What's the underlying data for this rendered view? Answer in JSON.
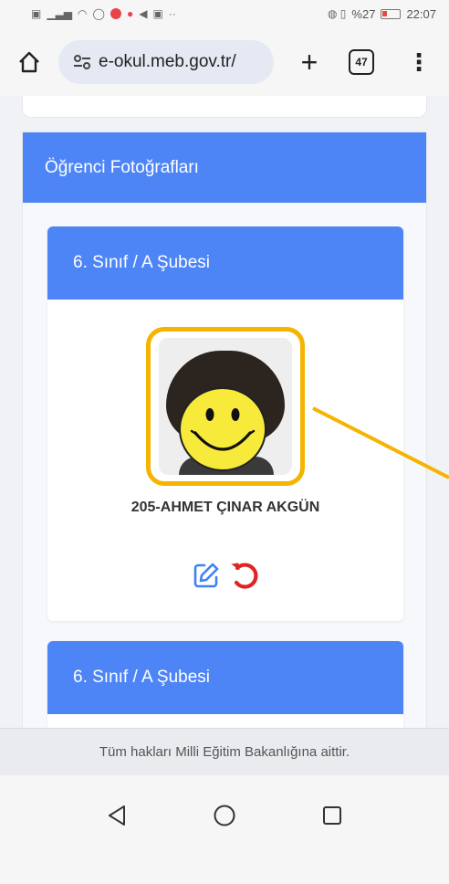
{
  "status": {
    "left_icons": [
      "sim-icon",
      "signal-icon",
      "wifi-icon",
      "whatsapp-icon",
      "app-icon",
      "location-icon",
      "send-icon",
      "image-icon",
      "more-icon"
    ],
    "right_text": "%27",
    "time": "22:07"
  },
  "browser": {
    "url": "e-okul.meb.gov.tr/",
    "tab_count": "47"
  },
  "page": {
    "section_title": "Öğrenci Fotoğrafları",
    "cards": [
      {
        "class_label": "6. Sınıf / A Şubesi",
        "student_name": "205-AHMET ÇINAR AKGÜN"
      },
      {
        "class_label": "6. Sınıf / A Şubesi"
      }
    ],
    "footer": "Tüm hakları Milli Eğitim Bakanlığına aittir."
  },
  "colors": {
    "header_blue": "#4e85f6",
    "highlight_yellow": "#f4b400",
    "edit_blue": "#3b82f6",
    "undo_red": "#e02424"
  }
}
